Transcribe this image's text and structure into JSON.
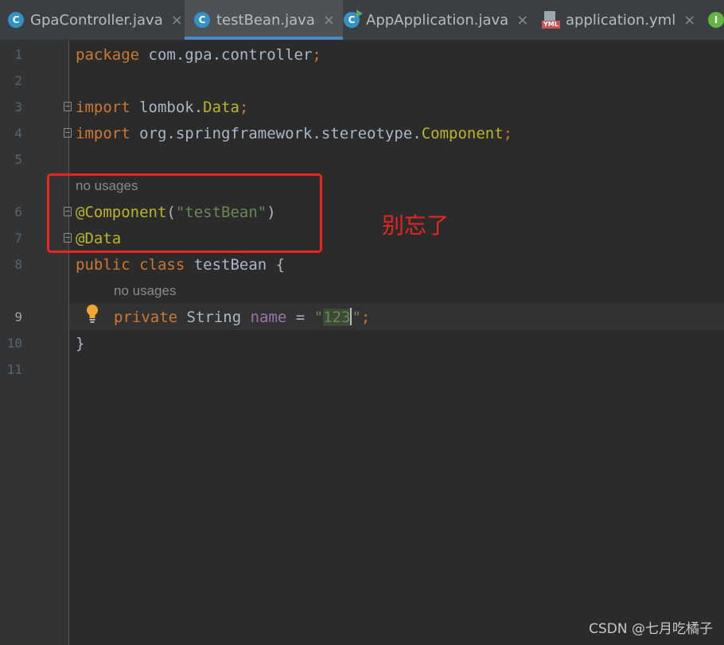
{
  "tabs": [
    {
      "label": "GpaController.java",
      "icon": "class-icon",
      "active": false
    },
    {
      "label": "testBean.java",
      "icon": "class-icon",
      "active": true
    },
    {
      "label": "AppApplication.java",
      "icon": "run-class-icon",
      "active": false
    },
    {
      "label": "application.yml",
      "icon": "yml-icon",
      "active": false
    },
    {
      "label": "I",
      "icon": "interface-icon",
      "active": false
    }
  ],
  "icons": {
    "class_letter": "C",
    "yml_label": "YML",
    "close_glyph": "×"
  },
  "line_numbers": [
    "1",
    "2",
    "3",
    "4",
    "5",
    "6",
    "7",
    "8",
    "9",
    "10",
    "11"
  ],
  "code": {
    "l1_kw": "package",
    "l1_rest": " com.gpa.controller",
    "l1_semi": ";",
    "l3_kw": "import",
    "l3_pkg": " lombok.",
    "l3_cls": "Data",
    "l3_semi": ";",
    "l4_kw": "import",
    "l4_pkg": " org.springframework.stereotype.",
    "l4_cls": "Component",
    "l4_semi": ";",
    "inlay_class": "no usages",
    "l6_anno": "@Component",
    "l6_open": "(",
    "l6_str": "\"testBean\"",
    "l6_close": ")",
    "l7_anno": "@Data",
    "l8_kw": "public class",
    "l8_name": " testBean {",
    "inlay_field": "no usages",
    "l9_kw": "private",
    "l9_type": " String ",
    "l9_field": "name",
    "l9_eq": " = ",
    "l9_q1": "\"",
    "l9_val": "123",
    "l9_q2": "\"",
    "l9_semi": ";",
    "l10": "}"
  },
  "annotation_note": "别忘了",
  "watermark": "CSDN @七月吃橘子",
  "colors": {
    "keyword": "#cc7832",
    "annotation": "#bbb529",
    "string": "#6a8759",
    "field": "#9876aa",
    "highlight_box": "#e8261f"
  }
}
